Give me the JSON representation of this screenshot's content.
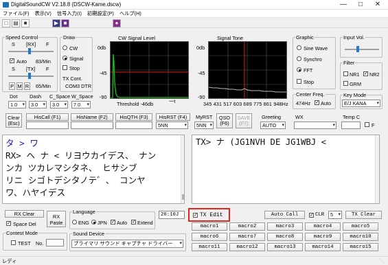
{
  "window": {
    "title": "DigitalSoundCW V2.18.8  (DSCW-Kame.dscw)"
  },
  "menu": [
    "ファイル(F)",
    "表示(V)",
    "信号入力(I)",
    "初期設定(P)",
    "ヘルプ(H)"
  ],
  "speed": {
    "legend": "Speed Control",
    "s1": "S",
    "rx": "[RX]",
    "f1": "F",
    "auto": "Auto",
    "rx_speed": "83/Min",
    "s2": "S",
    "tx": "[TX]",
    "f2": "F",
    "p": "P",
    "m": "M",
    "r": "R",
    "tx_speed": "65/Min"
  },
  "draw": {
    "legend": "Draw",
    "cw": "CW",
    "signal": "Signal",
    "stop": "Stop",
    "tx_cont_label": "TX Cont.",
    "tx_cont_value": "COM3 DTR"
  },
  "cw_level": {
    "title": "CW Signal Level",
    "top": "0db",
    "mid": "-45",
    "bot": "-90",
    "threshold": "Threshold -46db",
    "arrow": "一t"
  },
  "signal_tone": {
    "title": "Signal Tone",
    "top": "0db",
    "mid": "-45",
    "bot": "-90",
    "freqs": "345 431 517 603 689 775 861 948Hz"
  },
  "graphic": {
    "legend": "Graphic",
    "sine": "Sine Wave",
    "synchro": "Synchro",
    "fft": "FFT",
    "stop": "Stop"
  },
  "center_freq": {
    "legend": "Center Freq.",
    "value": "474Hz",
    "auto": "Auto"
  },
  "input_vol": {
    "legend": "Input Vol."
  },
  "filter": {
    "legend": "Filter",
    "nr1": "NR1",
    "nr2": "NR2",
    "grm": "GRM"
  },
  "key_mode": {
    "legend": "Key Mode",
    "value": "E/J KANA"
  },
  "params": {
    "dot": "Dot",
    "dash": "Dash",
    "cspace": "C_Space",
    "wspace": "W_Space",
    "dot_v": "1.0",
    "dash_v": "3.0",
    "cspace_v": "3.0",
    "wspace_v": "7.0"
  },
  "row2": {
    "clear": "Clear",
    "esc": "(Esc)",
    "hiscall": "HisCall (F1)",
    "hisname": "HisName (F2)",
    "histh": "HisQTH (F3)",
    "hisrst": "HisRST (F4)",
    "hisrst_v": "5NN",
    "myrst": "MyRST",
    "myrst_v": "5NN",
    "qso1": "QSO",
    "qso2": "(F6)",
    "save1": "SAVE",
    "save2": "(F7)",
    "greeting": "Greeting",
    "greeting_v": "AUTO",
    "wx": "WX",
    "tempc": "Temp C",
    "f": "F"
  },
  "rx_text": {
    "line1": "タ > ワ",
    "line2": "RX> ヘ ナ < リヨウカイデス、 ナン",
    "line3": "ンカ ツカレマシタネ、 ヒサシブ",
    "line4": "リニ シゴトデシタノテ゛、 コンヤ",
    "line5": "ワ、ハヤイデス"
  },
  "tx_text": "TX> ナ (JG1NVH DE JG1WBJ <",
  "bottom": {
    "rx_clear": "RX Clear",
    "space_del": "Space Del",
    "rx1": "RX",
    "rx2": "Paste",
    "language": "Language",
    "eng": "ENG",
    "jpn": "JPN",
    "auto": "Auto",
    "extend": "Extend",
    "time": "20:10J",
    "tx_edit": "TX Edit",
    "auto_call": "Auto Call",
    "clr": "CLR",
    "num": "5",
    "tx_clear": "TX Clear",
    "contest": "Contest Mode",
    "test": "TEST",
    "no": "No.",
    "sound_device": "Sound Device",
    "sound_v": "プライマリ サウンド キャプチャ ドライバー"
  },
  "macros": [
    "macro1",
    "macro2",
    "macro3",
    "macro4",
    "macro5",
    "macro6",
    "macro7",
    "macro8",
    "macro9",
    "macro10",
    "macro11",
    "macro12",
    "macro13",
    "macro14",
    "macro15"
  ],
  "status": "レディ"
}
